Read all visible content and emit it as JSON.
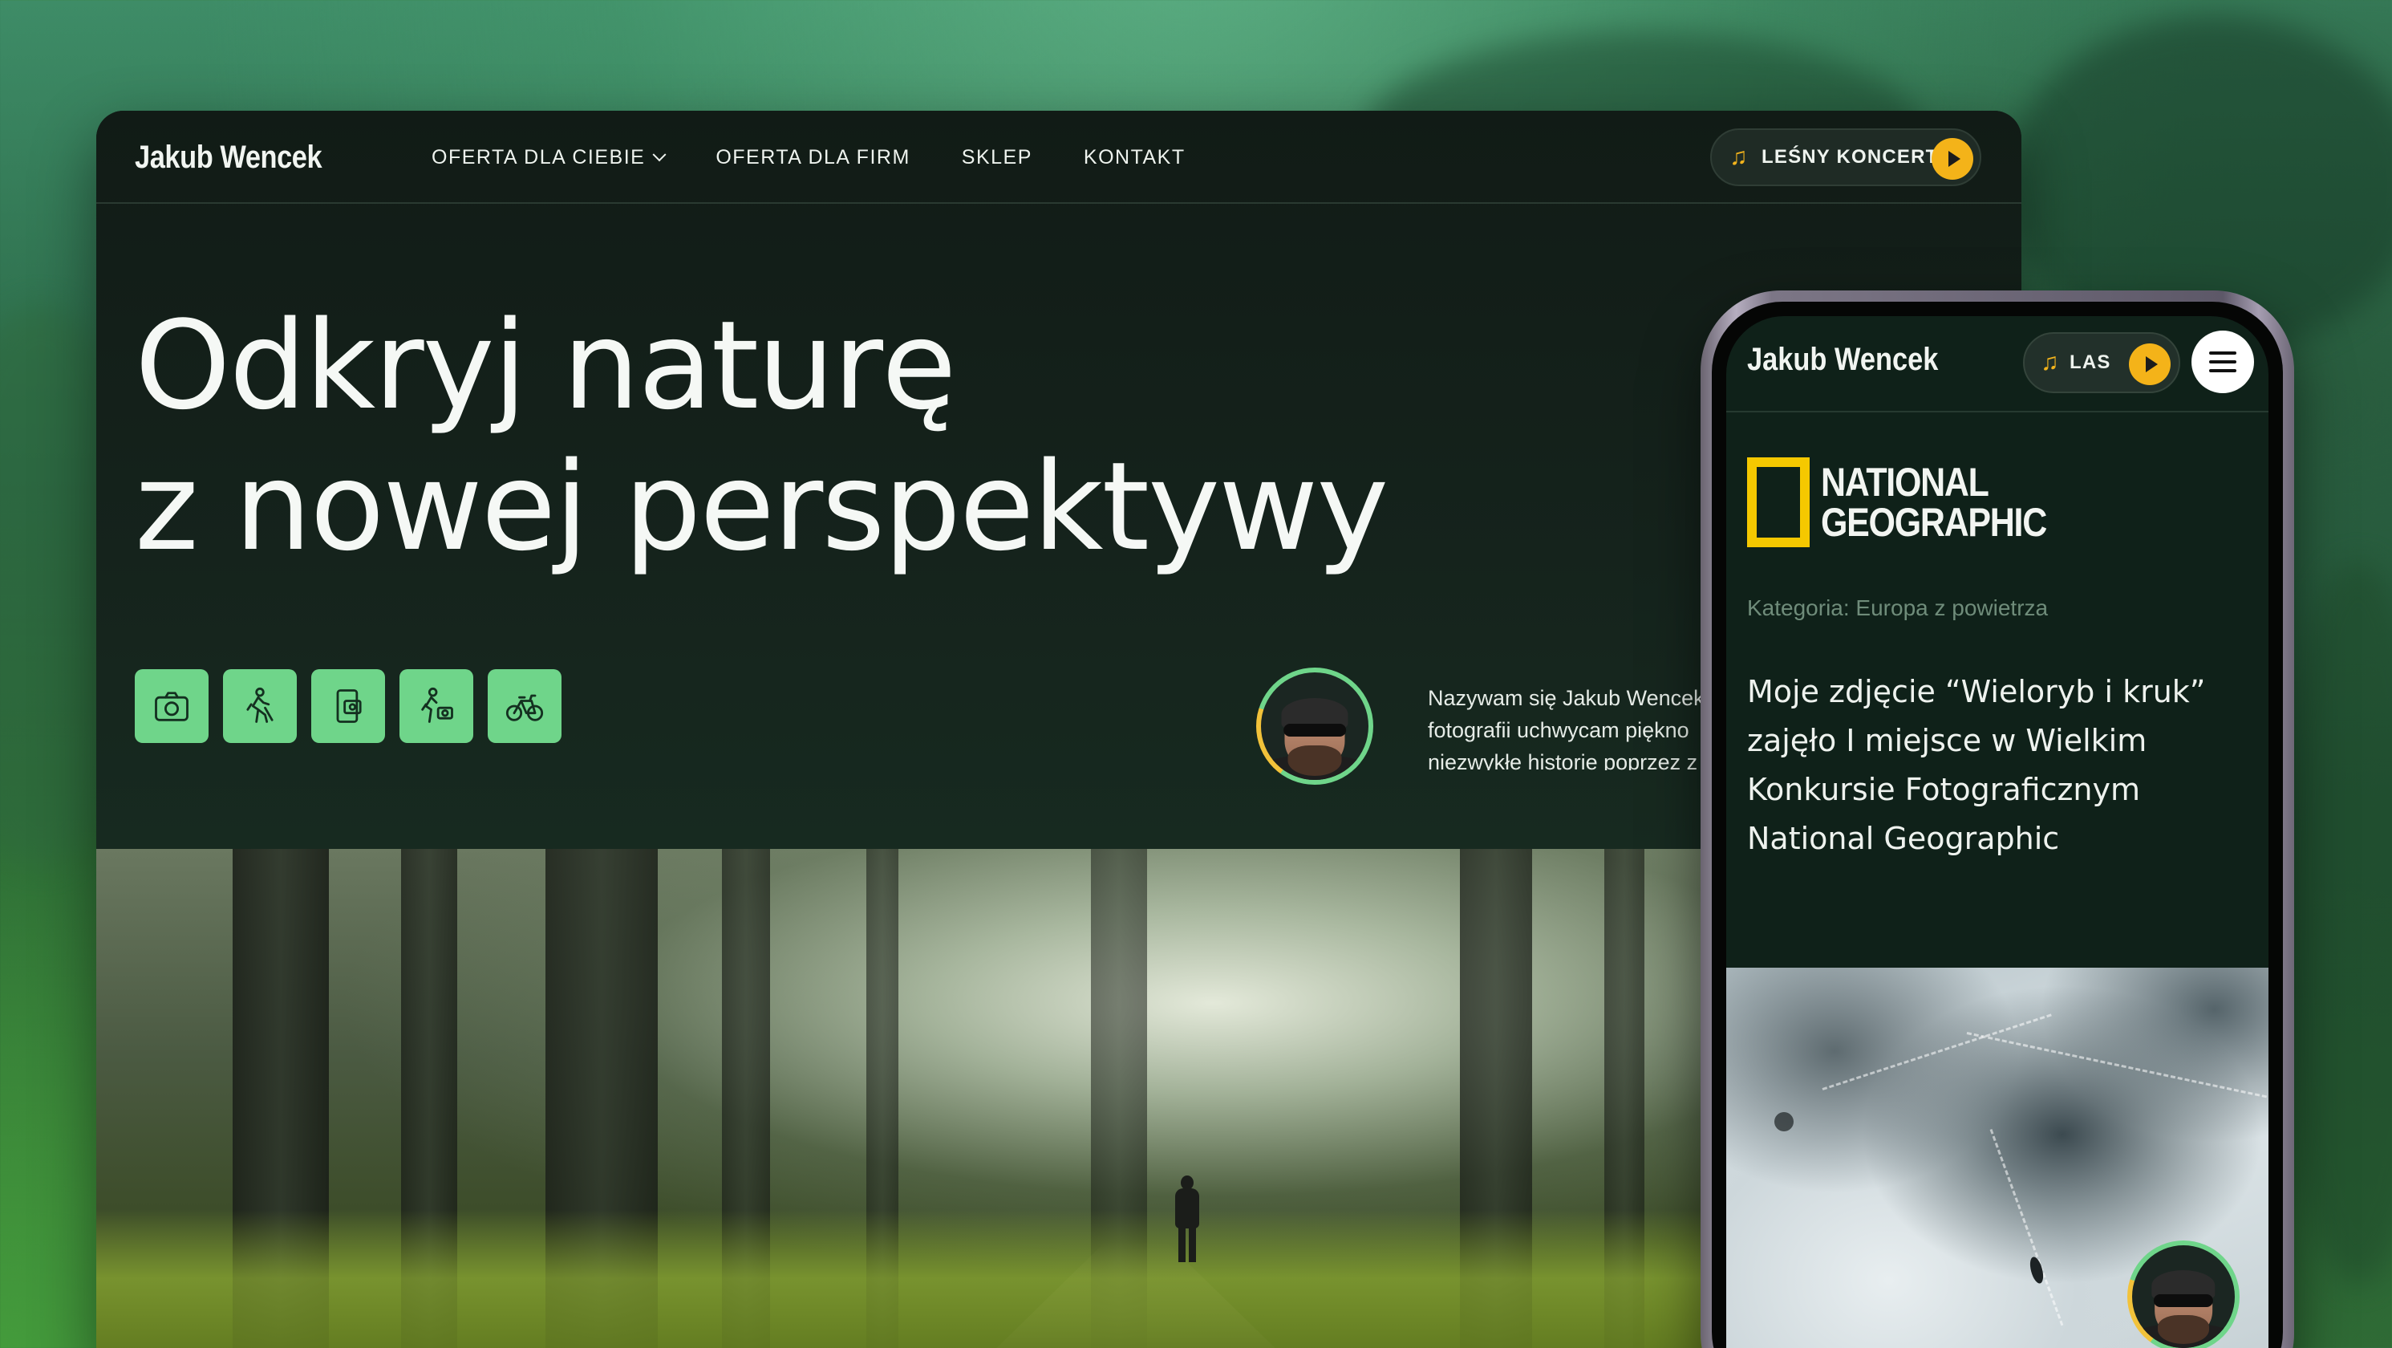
{
  "desktop": {
    "brand": "Jakub Wencek",
    "nav": [
      {
        "label": "OFERTA DLA CIEBIE",
        "has_dropdown": true
      },
      {
        "label": "OFERTA DLA FIRM"
      },
      {
        "label": "SKLEP"
      },
      {
        "label": "KONTAKT"
      }
    ],
    "concert_button": {
      "label": "LEŚNY KONCERT",
      "icon": "music-note-icon",
      "action_icon": "play-icon"
    },
    "headline": [
      "Odkryj naturę",
      "z nowej perspektywy"
    ],
    "service_icons": [
      "camera-icon",
      "hiking-icon",
      "phone-photo-icon",
      "hiking-camera-icon",
      "bicycle-icon"
    ],
    "bio_lines": [
      "Nazywam się Jakub Wencek",
      "fotografii uchwycam piękno",
      "niezwykłe historie poprzez z"
    ]
  },
  "phone": {
    "brand": "Jakub Wencek",
    "las_button": {
      "label": "LAS",
      "icon": "music-note-icon",
      "action_icon": "play-icon"
    },
    "menu_icon": "hamburger-menu-icon",
    "logo_lines": [
      "NATIONAL",
      "GEOGRAPHIC"
    ],
    "category": "Kategoria: Europa z powietrza",
    "story": "Moje zdjęcie “Wieloryb i kruk” zajęło I miejsce w Wielkim Konkursie Fotograficznym National Geographic"
  },
  "colors": {
    "accent_green": "#6fd58a",
    "accent_yellow": "#f4b319",
    "dark_bg": "#121c17",
    "ng_yellow": "#f5c800"
  }
}
